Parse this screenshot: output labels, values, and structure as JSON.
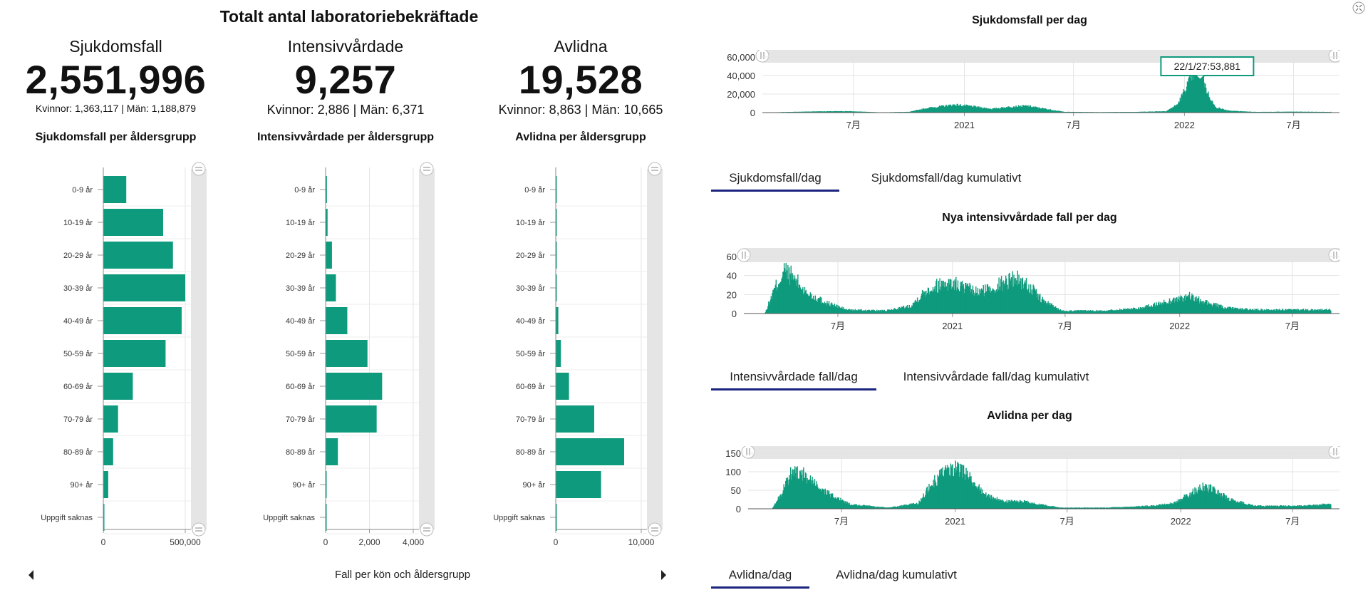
{
  "header": {
    "title": "Totalt antal laboratoriebekräftade"
  },
  "stats": [
    {
      "label": "Sjukdomsfall",
      "value": "2,551,996",
      "sub": "Kvinnor: 1,363,117 | Män: 1,188,879"
    },
    {
      "label": "Intensivvårdade",
      "value": "9,257",
      "sub": "Kvinnor: 2,886 | Män: 6,371"
    },
    {
      "label": "Avlidna",
      "value": "19,528",
      "sub": "Kvinnor: 8,863 | Män: 10,665"
    }
  ],
  "footer": {
    "caption": "Fall per kön och åldersgrupp"
  },
  "colors": {
    "bar": "#0e9a7c",
    "axis": "#999999",
    "scroll": "#e5e5e5",
    "tab_underline": "#1a237e"
  },
  "icons": {
    "nav_left": "triangle-left-icon",
    "nav_right": "triangle-right-icon",
    "corner": "expand-icon",
    "handle": "grip-handle-icon"
  },
  "chart_data": [
    {
      "type": "bar",
      "orientation": "horizontal",
      "title": "Sjukdomsfall per åldersgrupp",
      "categories": [
        "0-9 år",
        "10-19 år",
        "20-29 år",
        "30-39 år",
        "40-49 år",
        "50-59 år",
        "60-69 år",
        "70-79 år",
        "80-89 år",
        "90+ år",
        "Uppgift saknas"
      ],
      "values": [
        140000,
        365000,
        425000,
        500000,
        478000,
        380000,
        180000,
        90000,
        60000,
        30000,
        2000
      ],
      "xlim": [
        0,
        500000
      ],
      "xticks": [
        "0",
        "500,000"
      ]
    },
    {
      "type": "bar",
      "orientation": "horizontal",
      "title": "Intensivvårdade per åldersgrupp",
      "categories": [
        "0-9 år",
        "10-19 år",
        "20-29 år",
        "30-39 år",
        "40-49 år",
        "50-59 år",
        "60-69 år",
        "70-79 år",
        "80-89 år",
        "90+ år",
        "Uppgift saknas"
      ],
      "values": [
        60,
        90,
        290,
        470,
        990,
        1910,
        2580,
        2330,
        560,
        20,
        10
      ],
      "xlim": [
        0,
        4000
      ],
      "xticks": [
        "0",
        "2,000",
        "4,000"
      ]
    },
    {
      "type": "bar",
      "orientation": "horizontal",
      "title": "Avlidna per åldersgrupp",
      "categories": [
        "0-9 år",
        "10-19 år",
        "20-29 år",
        "30-39 år",
        "40-49 år",
        "50-59 år",
        "60-69 år",
        "70-79 år",
        "80-89 år",
        "90+ år",
        "Uppgift saknas"
      ],
      "values": [
        10,
        20,
        50,
        120,
        300,
        600,
        1550,
        4500,
        8000,
        5300,
        20
      ],
      "xlim": [
        0,
        10000
      ],
      "xticks": [
        "0",
        "10,000"
      ]
    },
    {
      "type": "area",
      "title": "Sjukdomsfall per dag",
      "x_range": [
        "2020-02",
        "2022-09"
      ],
      "xticks": [
        {
          "label": "7月",
          "date": "2020-07-01"
        },
        {
          "label": "2021",
          "date": "2021-01-01"
        },
        {
          "label": "7月",
          "date": "2021-07-01"
        },
        {
          "label": "2022",
          "date": "2022-01-01"
        },
        {
          "label": "7月",
          "date": "2022-07-01"
        }
      ],
      "ylim": [
        0,
        60000
      ],
      "yticks": [
        "0",
        "20,000",
        "40,000",
        "60,000"
      ],
      "tooltip": "22/1/27:53,881",
      "series_points": [
        [
          "2020-02-01",
          0
        ],
        [
          "2020-03-15",
          700
        ],
        [
          "2020-05-01",
          1300
        ],
        [
          "2020-06-20",
          1500
        ],
        [
          "2020-08-15",
          300
        ],
        [
          "2020-10-01",
          800
        ],
        [
          "2020-11-01",
          5000
        ],
        [
          "2020-12-15",
          8500
        ],
        [
          "2021-01-10",
          7000
        ],
        [
          "2021-02-15",
          4000
        ],
        [
          "2021-03-20",
          6500
        ],
        [
          "2021-04-15",
          7200
        ],
        [
          "2021-05-15",
          4000
        ],
        [
          "2021-06-15",
          800
        ],
        [
          "2021-08-15",
          500
        ],
        [
          "2021-10-15",
          800
        ],
        [
          "2021-12-01",
          1500
        ],
        [
          "2021-12-20",
          9000
        ],
        [
          "2022-01-05",
          30000
        ],
        [
          "2022-01-15",
          42000
        ],
        [
          "2022-01-27",
          53881
        ],
        [
          "2022-02-05",
          25000
        ],
        [
          "2022-02-20",
          6000
        ],
        [
          "2022-03-15",
          2000
        ],
        [
          "2022-05-01",
          700
        ],
        [
          "2022-07-01",
          1000
        ],
        [
          "2022-08-15",
          800
        ]
      ],
      "tabs": [
        "Sjukdomsfall/dag",
        "Sjukdomsfall/dag kumulativt"
      ],
      "active_tab": 0
    },
    {
      "type": "area",
      "title": "Nya intensivvårdade fall per dag",
      "x_range": [
        "2020-02",
        "2022-09"
      ],
      "xticks": [
        {
          "label": "7月",
          "date": "2020-07-01"
        },
        {
          "label": "2021",
          "date": "2021-01-01"
        },
        {
          "label": "7月",
          "date": "2021-07-01"
        },
        {
          "label": "2022",
          "date": "2022-01-01"
        },
        {
          "label": "7月",
          "date": "2022-07-01"
        }
      ],
      "ylim": [
        0,
        60
      ],
      "yticks": [
        "0",
        "20",
        "40",
        "60"
      ],
      "series_points": [
        [
          "2020-02-01",
          0
        ],
        [
          "2020-03-05",
          0
        ],
        [
          "2020-03-20",
          25
        ],
        [
          "2020-04-05",
          45
        ],
        [
          "2020-04-20",
          38
        ],
        [
          "2020-05-10",
          22
        ],
        [
          "2020-06-10",
          12
        ],
        [
          "2020-07-15",
          4
        ],
        [
          "2020-09-15",
          3
        ],
        [
          "2020-10-25",
          8
        ],
        [
          "2020-11-20",
          25
        ],
        [
          "2020-12-20",
          33
        ],
        [
          "2021-01-10",
          30
        ],
        [
          "2021-02-10",
          22
        ],
        [
          "2021-03-15",
          30
        ],
        [
          "2021-04-10",
          38
        ],
        [
          "2021-05-01",
          30
        ],
        [
          "2021-05-25",
          14
        ],
        [
          "2021-06-25",
          3
        ],
        [
          "2021-09-01",
          3
        ],
        [
          "2021-11-01",
          6
        ],
        [
          "2021-12-20",
          14
        ],
        [
          "2022-01-15",
          18
        ],
        [
          "2022-02-10",
          12
        ],
        [
          "2022-03-15",
          6
        ],
        [
          "2022-05-01",
          4
        ],
        [
          "2022-08-15",
          4
        ]
      ],
      "tabs": [
        "Intensivvårdade fall/dag",
        "Intensivvårdade fall/dag kumulativt"
      ],
      "active_tab": 0
    },
    {
      "type": "area",
      "title": "Avlidna per dag",
      "x_range": [
        "2020-02",
        "2022-09"
      ],
      "xticks": [
        {
          "label": "7月",
          "date": "2020-07-01"
        },
        {
          "label": "2021",
          "date": "2021-01-01"
        },
        {
          "label": "7月",
          "date": "2021-07-01"
        },
        {
          "label": "2022",
          "date": "2022-01-01"
        },
        {
          "label": "7月",
          "date": "2022-07-01"
        }
      ],
      "ylim": [
        0,
        150
      ],
      "yticks": [
        "0",
        "50",
        "100",
        "150"
      ],
      "series_points": [
        [
          "2020-02-01",
          0
        ],
        [
          "2020-03-10",
          0
        ],
        [
          "2020-03-25",
          40
        ],
        [
          "2020-04-12",
          105
        ],
        [
          "2020-04-25",
          100
        ],
        [
          "2020-05-15",
          70
        ],
        [
          "2020-06-10",
          40
        ],
        [
          "2020-07-15",
          12
        ],
        [
          "2020-09-15",
          3
        ],
        [
          "2020-11-01",
          15
        ],
        [
          "2020-11-25",
          70
        ],
        [
          "2020-12-15",
          100
        ],
        [
          "2021-01-05",
          110
        ],
        [
          "2021-01-25",
          80
        ],
        [
          "2021-02-20",
          35
        ],
        [
          "2021-03-20",
          20
        ],
        [
          "2021-04-20",
          20
        ],
        [
          "2021-05-15",
          12
        ],
        [
          "2021-06-20",
          3
        ],
        [
          "2021-09-01",
          3
        ],
        [
          "2021-11-15",
          8
        ],
        [
          "2021-12-20",
          15
        ],
        [
          "2022-01-20",
          45
        ],
        [
          "2022-02-05",
          60
        ],
        [
          "2022-02-25",
          50
        ],
        [
          "2022-03-20",
          25
        ],
        [
          "2022-05-01",
          8
        ],
        [
          "2022-07-20",
          8
        ],
        [
          "2022-08-20",
          12
        ]
      ],
      "tabs": [
        "Avlidna/dag",
        "Avlidna/dag kumulativt"
      ],
      "active_tab": 0
    }
  ]
}
